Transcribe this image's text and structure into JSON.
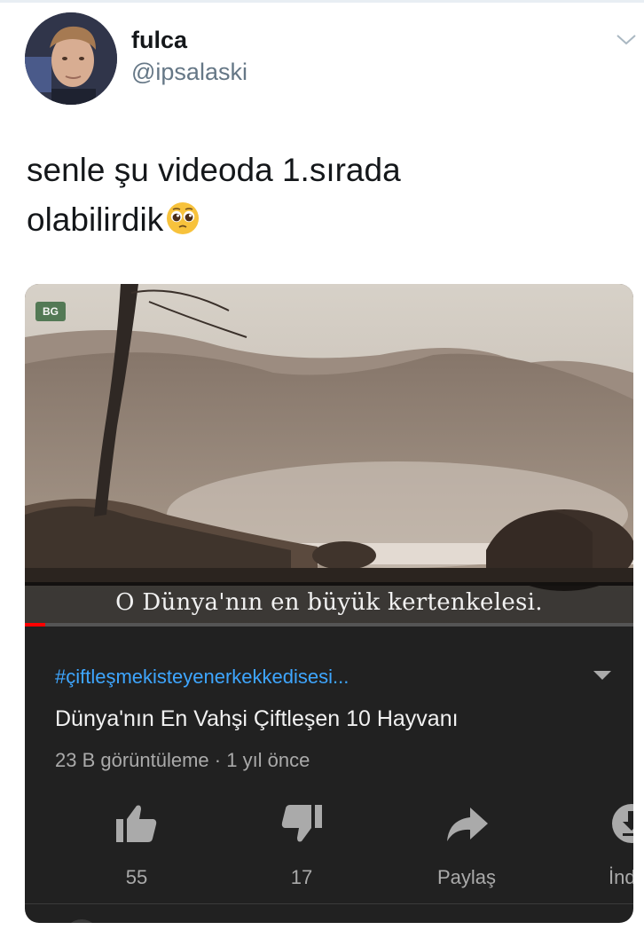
{
  "tweet": {
    "user": {
      "name": "fulca",
      "handle": "@ipsalaski"
    },
    "text_line1": "senle şu videoda 1.sırada",
    "text_line2": "olabilirdik",
    "emoji": "pleading-face-emoji"
  },
  "video": {
    "subtitle": "O Dünya'nın en büyük kertenkelesi.",
    "channel_logo_text": "BG",
    "progress_fraction": 0.034,
    "hashtag": "#çiftleşmekisteyenerkekkedisesi...",
    "title": "Dünya'nın En Vahşi Çiftleşen 10 Hayvanı",
    "meta": "23 B görüntüleme · 1 yıl önce"
  },
  "actions": [
    {
      "icon": "thumbs-up-icon",
      "label": "55"
    },
    {
      "icon": "thumbs-down-icon",
      "label": "17"
    },
    {
      "icon": "share-icon",
      "label": "Paylaş"
    },
    {
      "icon": "download-icon",
      "label": "İnd"
    }
  ],
  "colors": {
    "hashtag": "#3ea6ff",
    "card_bg": "#212121",
    "progress": "#ff0000",
    "handle": "#657786"
  }
}
